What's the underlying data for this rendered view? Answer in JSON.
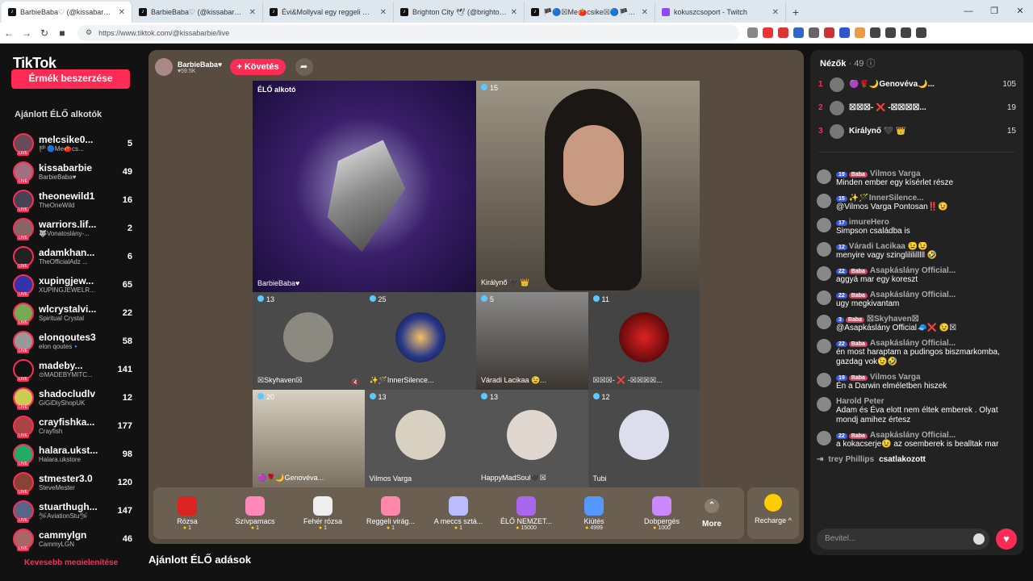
{
  "browser": {
    "tabs": [
      {
        "title": "BarbieBaba♡ (@kissabarbie)",
        "icon": "tiktok-icon",
        "active": true
      },
      {
        "title": "BarbieBaba♡ (@kissabarbie) ÉL",
        "icon": "tiktok-icon"
      },
      {
        "title": "Évi&Mollyval egy reggeli 🙈😍 (@m",
        "icon": "tiktok-icon"
      },
      {
        "title": "Brighton City 🕊 (@brighton.city) ÉLŐ",
        "icon": "tiktok-icon"
      },
      {
        "title": "🏴🔵☒Me🍅csike☒🔵🏴 (@melc",
        "icon": "tiktok-icon"
      },
      {
        "title": "kokuszcsoport - Twitch",
        "icon": "twitch-icon"
      }
    ],
    "url": "https://www.tiktok.com/@kissabarbie/live"
  },
  "sidebar": {
    "logo": "TikTok",
    "coin_button": "Érmék beszerzése",
    "title": "Ajánlott ÉLŐ alkotók",
    "creators": [
      {
        "name": "melcsike0...",
        "sub": "🏴🔵Me🍅cs...",
        "count": "5",
        "color": "#6a4a5a"
      },
      {
        "name": "kissabarbie",
        "sub": "BarbieBaba♥",
        "count": "49",
        "color": "#a07080"
      },
      {
        "name": "theonewild1",
        "sub": "TheOneWild",
        "count": "16",
        "color": "#445"
      },
      {
        "name": "warriors.lif...",
        "sub": "🐺Vonatoslány-...",
        "count": "2",
        "color": "#866"
      },
      {
        "name": "adamkhan...",
        "sub": "TheOfficialAdz ...",
        "count": "6",
        "color": "#222"
      },
      {
        "name": "xupingjew...",
        "sub": "XUPINGJEWELR...",
        "count": "65",
        "color": "#33a"
      },
      {
        "name": "wlcrystalvi...",
        "sub": "Spiritual Crystal",
        "count": "22",
        "color": "#7a5"
      },
      {
        "name": "elonqoutes3",
        "sub": "elon qoutes🔹",
        "count": "58",
        "color": "#999"
      },
      {
        "name": "madeby...",
        "sub": "⊙MADEBYMITC...",
        "count": "141",
        "color": "#111"
      },
      {
        "name": "shadocludlv",
        "sub": "GiGiDiyShopUK",
        "count": "12",
        "color": "#cc5"
      },
      {
        "name": "crayfishka...",
        "sub": "Crayfish",
        "count": "177",
        "color": "#a44"
      },
      {
        "name": "halara.ukst...",
        "sub": "Halara.ukstore",
        "count": "98",
        "color": "#2a6"
      },
      {
        "name": "stmester3.0",
        "sub": "SteveMester",
        "count": "120",
        "color": "#843"
      },
      {
        "name": "stuarthugh...",
        "sub": "🛩AviationStu🛩",
        "count": "147",
        "color": "#568"
      },
      {
        "name": "cammylgn",
        "sub": "CammyLGN",
        "count": "46",
        "color": "#a66"
      }
    ],
    "see_more": "Kevesebb megjelenítése"
  },
  "stage": {
    "host_name": "BarbieBaba♥",
    "host_likes": "♥59.5K",
    "follow": "+ Követés",
    "main_label": "ÉLŐ alkotó",
    "cells": [
      {
        "label": "BarbieBaba♥",
        "badge": ""
      },
      {
        "label": "Királynő 🖤 👑",
        "badge": "15"
      },
      {
        "label": "☒Skyhaven☒",
        "badge": "13"
      },
      {
        "label": "✨🪄InnerSilence...",
        "badge": "25"
      },
      {
        "label": "Váradi Lacikaa 😉...",
        "badge": "5"
      },
      {
        "label": "☒☒☒- ❌ -☒☒☒☒...",
        "badge": "11"
      },
      {
        "label": "🟣🌹🌙Genovéva...",
        "badge": "20"
      },
      {
        "label": "Vilmos Varga",
        "badge": "13"
      },
      {
        "label": "HappyMadSoul🖤☒",
        "badge": "13"
      },
      {
        "label": "Tubi",
        "badge": "12"
      }
    ],
    "gifts": [
      {
        "name": "Rózsa",
        "price": "1",
        "color": "#d22"
      },
      {
        "name": "Szívpamacs",
        "price": "1",
        "color": "#f8b"
      },
      {
        "name": "Fehér rózsa",
        "price": "1",
        "color": "#eee"
      },
      {
        "name": "Reggeli virág...",
        "price": "1",
        "color": "#f8a"
      },
      {
        "name": "A meccs sztá...",
        "price": "1",
        "color": "#bbf"
      },
      {
        "name": "ÉLŐ NEMZET...",
        "price": "15000",
        "color": "#a6e"
      },
      {
        "name": "Kiütés",
        "price": "4999",
        "color": "#59f"
      },
      {
        "name": "Dobpergés",
        "price": "1000",
        "color": "#c8f"
      }
    ],
    "more": "More",
    "recharge": "Recharge ^"
  },
  "recommended_title": "Ajánlott ÉLŐ adások",
  "viewers": {
    "title": "Nézők",
    "count": "· 49",
    "top": [
      {
        "rank": "1",
        "name": "🟣🌹🌙Genovéva🌙...",
        "score": "105"
      },
      {
        "rank": "2",
        "name": "☒☒☒- ❌ -☒☒☒☒...",
        "score": "19"
      },
      {
        "rank": "3",
        "name": "Királynő 🖤 👑",
        "score": "15"
      }
    ]
  },
  "chat": [
    {
      "lv": "19",
      "fan": "Baba",
      "name": "Vilmos Varga",
      "text": "Minden ember egy kísérlet része"
    },
    {
      "lv": "15",
      "fan": "",
      "name": "✨🪄InnerSilence...",
      "text": "@Vilmos Varga Pontosan‼️😉"
    },
    {
      "lv": "17",
      "fan": "",
      "name": "imureHero",
      "text": "Simpson családba is"
    },
    {
      "lv": "12",
      "fan": "",
      "name": "Váradi Lacikaa 😉😉",
      "text": "menyire vagy szinglilililllll 🤣"
    },
    {
      "lv": "22",
      "fan": "Baba",
      "name": "Asapkáslány Official...",
      "text": "aggyá mar egy koreszt"
    },
    {
      "lv": "22",
      "fan": "Baba",
      "name": "Asapkáslány Official...",
      "text": "ugy megkivantam"
    },
    {
      "lv": "3",
      "fan": "Baba",
      "name": "☒Skyhaven☒",
      "text": "@Asapkáslány Official🧢❌ 😉☒"
    },
    {
      "lv": "22",
      "fan": "Baba",
      "name": "Asapkáslány Official...",
      "text": "én most haraptam a pudingos biszmarkomba, gazdag vok😉🤣"
    },
    {
      "lv": "19",
      "fan": "Baba",
      "name": "Vilmos Varga",
      "text": "Én a Darwin elméletben hiszek"
    },
    {
      "lv": "",
      "fan": "",
      "name": "Harold Peter",
      "text": "Adam és Éva elott nem éltek emberek . Olyat mondj amihez értesz"
    },
    {
      "lv": "22",
      "fan": "Baba",
      "name": "Asapkáslány Official...",
      "text": "a kokacserje😉 az osemberek is bealltak mar"
    }
  ],
  "joined": {
    "name": "trey Phillips",
    "text": "csatlakozott"
  },
  "input_placeholder": "Bevitel..."
}
